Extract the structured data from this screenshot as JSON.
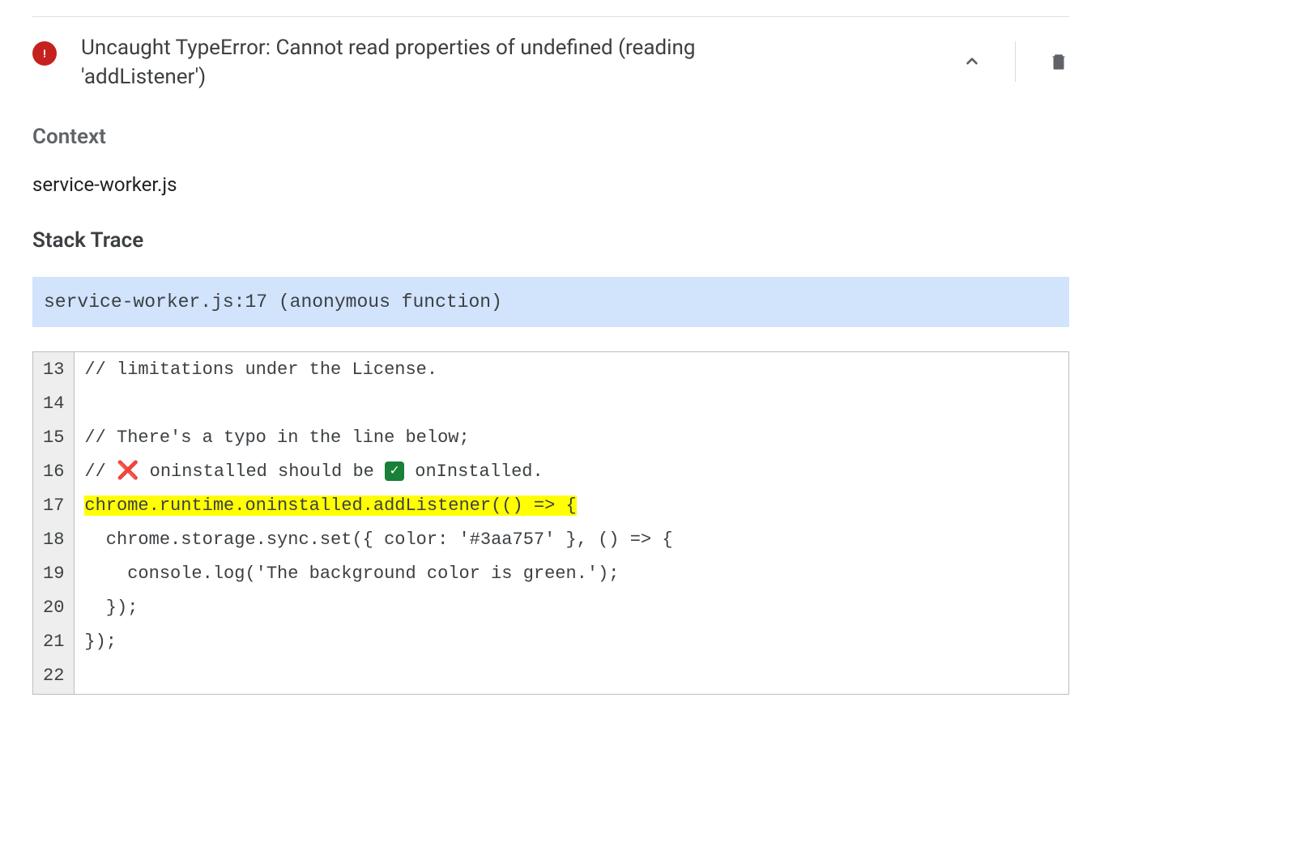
{
  "error": {
    "title": "Uncaught TypeError: Cannot read properties of undefined (reading 'addListener')"
  },
  "context": {
    "heading": "Context",
    "filename": "service-worker.js"
  },
  "stackTrace": {
    "heading": "Stack Trace",
    "frame": "service-worker.js:17 (anonymous function)"
  },
  "code": {
    "highlightedLine": 17,
    "lines": [
      {
        "n": "13",
        "text": "// limitations under the License."
      },
      {
        "n": "14",
        "text": ""
      },
      {
        "n": "15",
        "text": "// There's a typo in the line below;"
      },
      {
        "n": "16",
        "prefix": "// ",
        "cross": "❌",
        "mid": " oninstalled should be ",
        "check": "✓",
        "suffix": " onInstalled."
      },
      {
        "n": "17",
        "text": "chrome.runtime.oninstalled.addListener(() => {",
        "highlight": true
      },
      {
        "n": "18",
        "text": "  chrome.storage.sync.set({ color: '#3aa757' }, () => {"
      },
      {
        "n": "19",
        "text": "    console.log('The background color is green.');"
      },
      {
        "n": "20",
        "text": "  });"
      },
      {
        "n": "21",
        "text": "});"
      },
      {
        "n": "22",
        "text": ""
      }
    ]
  }
}
